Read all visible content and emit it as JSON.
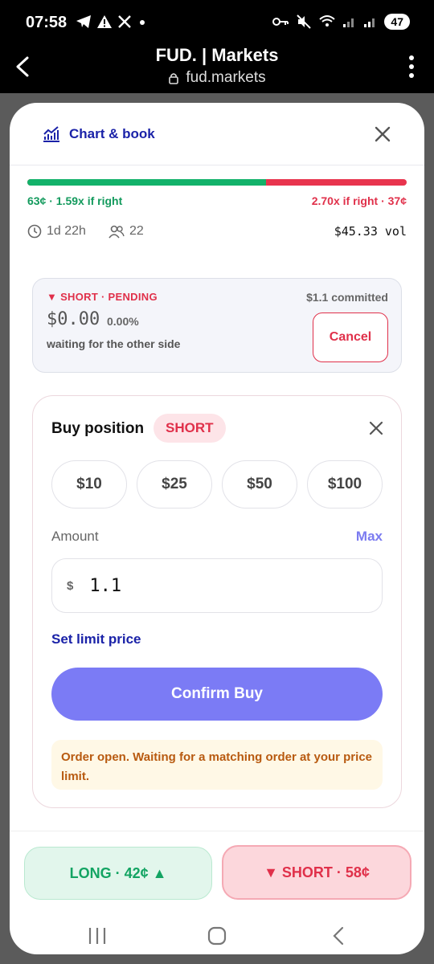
{
  "status_bar": {
    "time": "07:58",
    "battery": "47",
    "left_icons": [
      "telegram-icon",
      "warning-icon",
      "x-icon",
      "dot-icon"
    ],
    "right_icons": [
      "vpn-key-icon",
      "mute-icon",
      "wifi-icon",
      "signal-icon",
      "signal-icon"
    ]
  },
  "browser": {
    "title": "FUD. | Markets",
    "url": "fud.markets"
  },
  "sheet": {
    "chart_label": "Chart & book",
    "long_fraction": 0.63,
    "odds_left": "63¢ · 1.59x if right",
    "odds_right": "2.70x if right · 37¢",
    "time_left": "1d 22h",
    "participants": "22",
    "volume": "$45.33 vol"
  },
  "pending": {
    "title": "▼ SHORT · PENDING",
    "committed": "$1.1 committed",
    "amount": "$0.00",
    "pct": "0.00%",
    "waiting": "waiting for the other side",
    "cancel_label": "Cancel"
  },
  "buy": {
    "title": "Buy position",
    "side_pill": "SHORT",
    "presets": [
      "$10",
      "$25",
      "$50",
      "$100"
    ],
    "amount_label": "Amount",
    "max_label": "Max",
    "currency": "$",
    "amount_value": "1.1",
    "limit_label": "Set limit price",
    "confirm_label": "Confirm Buy",
    "notice": "Order open. Waiting for a matching order at your price limit."
  },
  "actions": {
    "long_label": "LONG · 42¢ ▲",
    "short_label": "▼ SHORT · 58¢"
  },
  "colors": {
    "accent": "#7b7bf5",
    "long": "#13b26a",
    "short": "#e0304a",
    "link": "#1a22a8"
  }
}
